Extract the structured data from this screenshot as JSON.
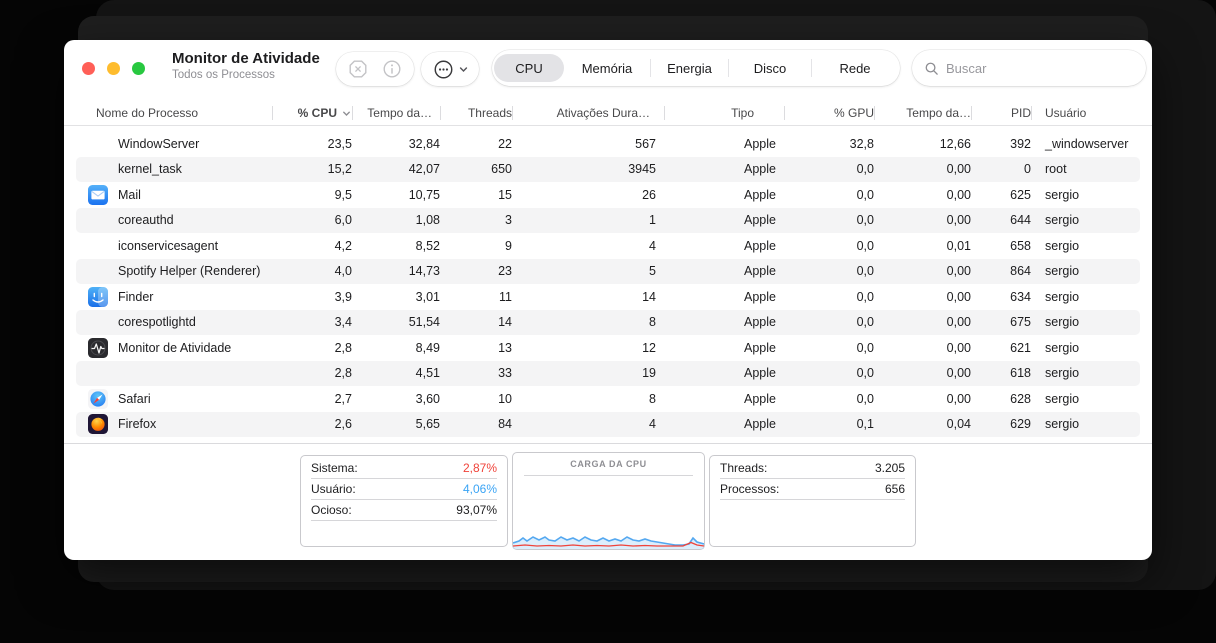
{
  "window": {
    "title": "Monitor de Atividade",
    "subtitle": "Todos os Processos"
  },
  "toolbar": {
    "actions": [
      {
        "key": "stop-process",
        "icon": "octagon-x-icon",
        "enabled": false
      },
      {
        "key": "inspect-process",
        "icon": "info-icon",
        "enabled": false
      },
      {
        "key": "more-options",
        "icon": "ellipsis-circle-icon",
        "enabled": true
      }
    ],
    "tabs": [
      {
        "key": "cpu",
        "label": "CPU",
        "selected": true
      },
      {
        "key": "memoria",
        "label": "Memória",
        "selected": false
      },
      {
        "key": "energia",
        "label": "Energia",
        "selected": false
      },
      {
        "key": "disco",
        "label": "Disco",
        "selected": false
      },
      {
        "key": "rede",
        "label": "Rede",
        "selected": false
      }
    ],
    "search": {
      "placeholder": "Buscar",
      "value": "",
      "icon": "search-icon"
    }
  },
  "table": {
    "columns": [
      {
        "key": "name",
        "label": "Nome do Processo"
      },
      {
        "key": "cpu-percent",
        "label": "% CPU",
        "sorted": "desc"
      },
      {
        "key": "cpu-time",
        "label": "Tempo da…"
      },
      {
        "key": "threads",
        "label": "Threads"
      },
      {
        "key": "idle-wakeups",
        "label": "Ativações Dura…"
      },
      {
        "key": "type",
        "label": "Tipo"
      },
      {
        "key": "gpu-percent",
        "label": "% GPU"
      },
      {
        "key": "gpu-time",
        "label": "Tempo da…"
      },
      {
        "key": "pid",
        "label": "PID"
      },
      {
        "key": "user",
        "label": "Usuário"
      }
    ],
    "rows": [
      {
        "icon": null,
        "name": "WindowServer",
        "values": [
          "23,5",
          "32,84",
          "22",
          "567",
          "Apple",
          "32,8",
          "12,66",
          "392",
          "_windowserver"
        ]
      },
      {
        "icon": null,
        "name": "kernel_task",
        "values": [
          "15,2",
          "42,07",
          "650",
          "3945",
          "Apple",
          "0,0",
          "0,00",
          "0",
          "root"
        ]
      },
      {
        "icon": "mail-app-icon",
        "name": "Mail",
        "values": [
          "9,5",
          "10,75",
          "15",
          "26",
          "Apple",
          "0,0",
          "0,00",
          "625",
          "sergio"
        ]
      },
      {
        "icon": null,
        "name": "coreauthd",
        "values": [
          "6,0",
          "1,08",
          "3",
          "1",
          "Apple",
          "0,0",
          "0,00",
          "644",
          "sergio"
        ]
      },
      {
        "icon": null,
        "name": "iconservicesagent",
        "values": [
          "4,2",
          "8,52",
          "9",
          "4",
          "Apple",
          "0,0",
          "0,01",
          "658",
          "sergio"
        ]
      },
      {
        "icon": null,
        "name": "Spotify Helper (Renderer)",
        "values": [
          "4,0",
          "14,73",
          "23",
          "5",
          "Apple",
          "0,0",
          "0,00",
          "864",
          "sergio"
        ]
      },
      {
        "icon": "finder-app-icon",
        "name": "Finder",
        "values": [
          "3,9",
          "3,01",
          "11",
          "14",
          "Apple",
          "0,0",
          "0,00",
          "634",
          "sergio"
        ]
      },
      {
        "icon": null,
        "name": "corespotlightd",
        "values": [
          "3,4",
          "51,54",
          "14",
          "8",
          "Apple",
          "0,0",
          "0,00",
          "675",
          "sergio"
        ]
      },
      {
        "icon": "activity-monitor-app-icon",
        "name": "Monitor de Atividade",
        "values": [
          "2,8",
          "8,49",
          "13",
          "12",
          "Apple",
          "0,0",
          "0,00",
          "621",
          "sergio"
        ]
      },
      {
        "icon": null,
        "name": "",
        "values": [
          "2,8",
          "4,51",
          "33",
          "19",
          "Apple",
          "0,0",
          "0,00",
          "618",
          "sergio"
        ]
      },
      {
        "icon": "safari-app-icon",
        "name": "Safari",
        "values": [
          "2,7",
          "3,60",
          "10",
          "8",
          "Apple",
          "0,0",
          "0,00",
          "628",
          "sergio"
        ]
      },
      {
        "icon": "firefox-app-icon",
        "name": "Firefox",
        "values": [
          "2,6",
          "5,65",
          "84",
          "4",
          "Apple",
          "0,1",
          "0,04",
          "629",
          "sergio"
        ]
      }
    ]
  },
  "footer": {
    "usage": {
      "rows": [
        {
          "label": "Sistema:",
          "value": "2,87%",
          "color": "#f0433a"
        },
        {
          "label": "Usuário:",
          "value": "4,06%",
          "color": "#3aa4f5"
        },
        {
          "label": "Ocioso:",
          "value": "93,07%",
          "color": "#1d1d1f"
        }
      ]
    },
    "graph": {
      "title": "CARGA DA CPU",
      "user_color": "#54a8f0",
      "system_color": "#f0433a"
    },
    "counts": {
      "rows": [
        {
          "label": "Threads:",
          "value": "3.205",
          "color": "#1d1d1f"
        },
        {
          "label": "Processos:",
          "value": "656",
          "color": "#1d1d1f"
        }
      ]
    }
  },
  "colors": {
    "traffic_close": "#ff5f57",
    "traffic_minimize": "#febc2e",
    "traffic_zoom": "#28c840",
    "selected_tab_bg": "#e3e3e6",
    "alt_row_bg": "#f4f4f5"
  }
}
